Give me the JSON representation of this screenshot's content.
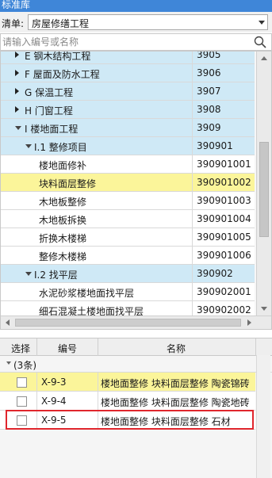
{
  "window": {
    "title": "标准库"
  },
  "filter": {
    "label": "清单:",
    "value": "房屋修缮工程"
  },
  "search": {
    "placeholder": "请输入编号或名称"
  },
  "tree": [
    {
      "name": "E 钢木结构工程",
      "code": "3905",
      "kind": "group",
      "level": 1,
      "state": "collapsed"
    },
    {
      "name": "F 屋面及防水工程",
      "code": "3906",
      "kind": "group",
      "level": 1,
      "state": "collapsed"
    },
    {
      "name": "G 保温工程",
      "code": "3907",
      "kind": "group",
      "level": 1,
      "state": "collapsed"
    },
    {
      "name": "H 门窗工程",
      "code": "3908",
      "kind": "group",
      "level": 1,
      "state": "collapsed"
    },
    {
      "name": "I 楼地面工程",
      "code": "3909",
      "kind": "group",
      "level": 1,
      "state": "expanded"
    },
    {
      "name": "I.1 整修项目",
      "code": "390901",
      "kind": "group",
      "level": 2,
      "state": "expanded"
    },
    {
      "name": "楼地面修补",
      "code": "390901001",
      "kind": "item",
      "level": 3
    },
    {
      "name": "块料面层整修",
      "code": "390901002",
      "kind": "item",
      "level": 3,
      "selected": true
    },
    {
      "name": "木地板整修",
      "code": "390901003",
      "kind": "item",
      "level": 3
    },
    {
      "name": "木地板拆换",
      "code": "390901004",
      "kind": "item",
      "level": 3
    },
    {
      "name": "折换木楼梯",
      "code": "390901005",
      "kind": "item",
      "level": 3
    },
    {
      "name": "整修木楼梯",
      "code": "390901006",
      "kind": "item",
      "level": 3
    },
    {
      "name": "I.2 找平层",
      "code": "390902",
      "kind": "group",
      "level": 2,
      "state": "expanded"
    },
    {
      "name": "水泥砂浆楼地面找平层",
      "code": "390902001",
      "kind": "item",
      "level": 3
    },
    {
      "name": "细石混凝土楼地面找平层",
      "code": "390902002",
      "kind": "item",
      "level": 3
    }
  ],
  "grid": {
    "headers": {
      "select": "选择",
      "code": "编号",
      "name": "名称"
    },
    "group_label": "(3条)",
    "rows": [
      {
        "code": "X-9-3",
        "name": "楼地面整修 块料面层整修 陶瓷锦砖",
        "checked": false,
        "selected": true
      },
      {
        "code": "X-9-4",
        "name": "楼地面整修 块料面层整修 陶瓷地砖",
        "checked": false,
        "selected": false
      },
      {
        "code": "X-9-5",
        "name": "楼地面整修 块料面层整修 石材",
        "checked": false,
        "selected": false
      }
    ]
  },
  "colors": {
    "title_bar": "#3f86d8",
    "group_row": "#cfe9f6",
    "selected_row": "#fbf59a",
    "annotation_box": "#e0262d"
  }
}
